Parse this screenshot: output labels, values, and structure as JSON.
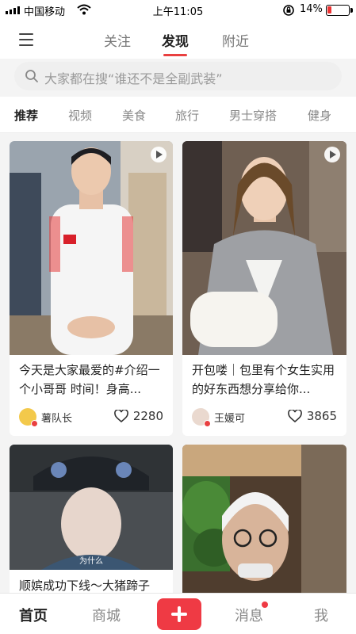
{
  "status": {
    "carrier": "中国移动",
    "time": "上午11:05",
    "battery": "14%"
  },
  "topnav": {
    "tabs": [
      "关注",
      "发现",
      "附近"
    ],
    "active": "发现"
  },
  "search": {
    "placeholder": "大家都在搜“谁还不是全副武装”"
  },
  "categories": [
    "推荐",
    "视频",
    "美食",
    "旅行",
    "男士穿搭",
    "健身"
  ],
  "feed": [
    {
      "title": "今天是大家最爱的#介绍一个小哥哥 时间！身高...",
      "author": "薯队长",
      "likes": "2280",
      "video": true
    },
    {
      "title": "开包喽｜包里有个女生实用的好东西想分享给你...",
      "author": "王媛可",
      "likes": "3865",
      "video": true
    },
    {
      "title": "顺嫔成功下线～大猪蹄子",
      "caption": "为什么",
      "video": false
    },
    {
      "title": "",
      "video": false
    }
  ],
  "bottomnav": {
    "home": "首页",
    "mall": "商城",
    "messages": "消息",
    "me": "我"
  },
  "colors": {
    "accent": "#ef3a44"
  }
}
